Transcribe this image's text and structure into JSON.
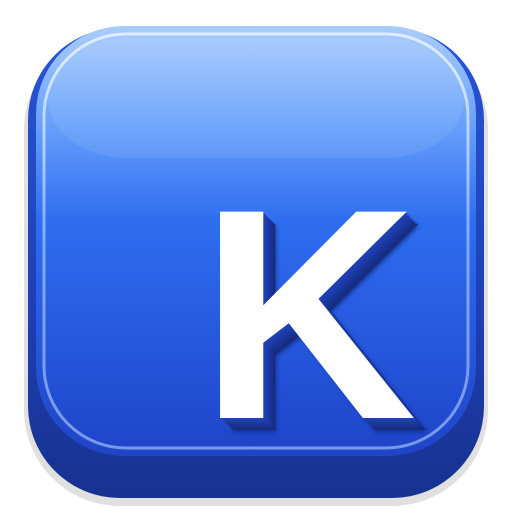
{
  "app_icon": {
    "letter": "K",
    "icon": "letter-k-app-icon",
    "colors": {
      "face_top": "#a9cdfd",
      "face_mid": "#2f6ef0",
      "face_bottom": "#1f44c8",
      "base": "#1c3aa6",
      "rim_highlight": "#c9ddff",
      "letter": "#ffffff",
      "letter_shadow": "#1d3cad"
    }
  }
}
